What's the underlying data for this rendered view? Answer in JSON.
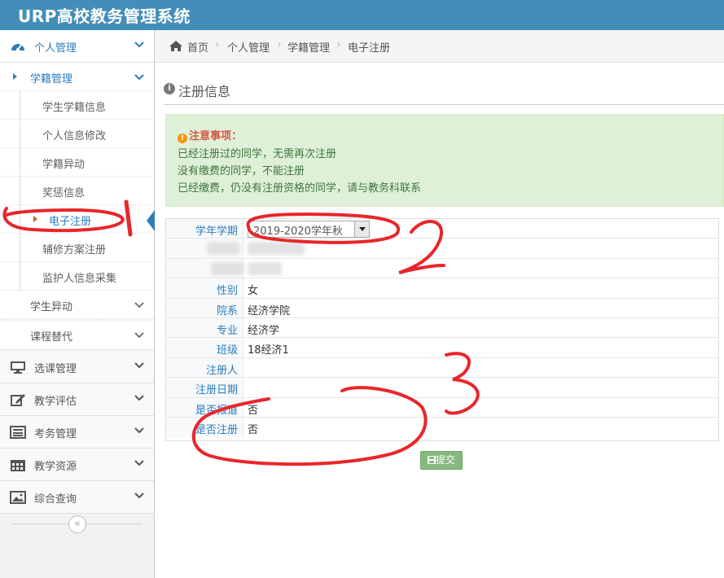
{
  "app": {
    "title": "URP高校教务管理系统"
  },
  "sidebar": {
    "items": [
      {
        "label": "个人管理",
        "icon": "dashboard-icon"
      },
      {
        "label": "选课管理",
        "icon": "monitor-icon"
      },
      {
        "label": "教学评估",
        "icon": "edit-icon"
      },
      {
        "label": "考务管理",
        "icon": "list-icon"
      },
      {
        "label": "教学资源",
        "icon": "calendar-icon"
      },
      {
        "label": "综合查询",
        "icon": "picture-icon"
      }
    ],
    "subgroups": [
      {
        "label": "学籍管理"
      },
      {
        "label": "学生异动"
      },
      {
        "label": "课程替代"
      }
    ],
    "leaves": [
      {
        "label": "学生学籍信息"
      },
      {
        "label": "个人信息修改"
      },
      {
        "label": "学籍异动"
      },
      {
        "label": "奖惩信息"
      },
      {
        "label": "电子注册"
      },
      {
        "label": "辅修方案注册"
      },
      {
        "label": "监护人信息采集"
      }
    ],
    "collapse_glyph": "«"
  },
  "breadcrumb": {
    "items": [
      "首页",
      "个人管理",
      "学籍管理",
      "电子注册"
    ],
    "separator": "›"
  },
  "section": {
    "title": "注册信息",
    "info_glyph": "i"
  },
  "notice": {
    "warn_glyph": "!",
    "heading": "注意事项：",
    "lines": [
      "已经注册过的同学，无需再次注册",
      "没有缴费的同学，不能注册",
      "已经缴费，仍没有注册资格的同学，请与教务科联系"
    ]
  },
  "form": {
    "term_label": "学年学期",
    "term_value": "2019-2020学年秋",
    "fields": [
      {
        "label": "性别",
        "value": "女"
      },
      {
        "label": "院系",
        "value": "经济学院"
      },
      {
        "label": "专业",
        "value": "经济学"
      },
      {
        "label": "班级",
        "value": "18经济1"
      },
      {
        "label": "注册人",
        "value": ""
      },
      {
        "label": "注册日期",
        "value": ""
      },
      {
        "label": "是否报道",
        "value": "否"
      },
      {
        "label": "是否注册",
        "value": "否"
      }
    ]
  },
  "submit": {
    "label": "提交",
    "icon": "save-icon"
  },
  "colors": {
    "header": "#438eb9",
    "link": "#2b7dbc",
    "notice_bg": "#dff0d8",
    "submit": "#87b87f",
    "annotation": "#e8262b"
  }
}
